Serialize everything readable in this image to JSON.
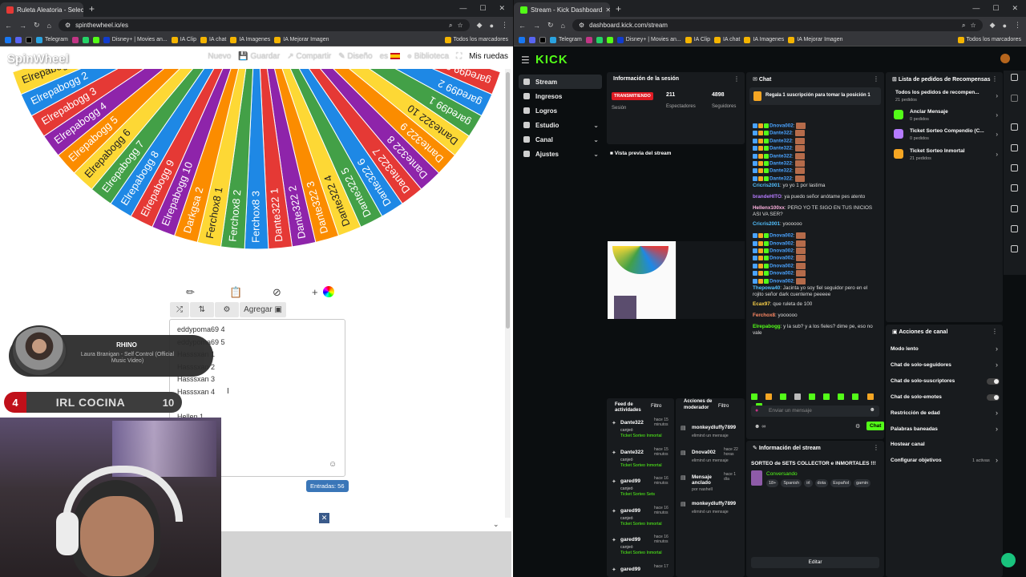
{
  "left_browser": {
    "tab_title": "Ruleta Aleatoria - Selector Pers...",
    "url": "spinthewheel.io/es",
    "bookmarks": [
      "Telegram",
      "Disney+ | Movies an...",
      "IA Clip",
      "IA chat",
      "IA Imagenes",
      "IA Mejorar Imagen"
    ],
    "bookmarks_end": "Todos los marcadores"
  },
  "spinwheel": {
    "logo": "SpinWheel",
    "menu": {
      "new": "Nuevo",
      "save": "Guardar",
      "share": "Compartir",
      "design": "Diseño",
      "lang": "es",
      "library": "Biblioteca",
      "my_wheels": "Mis ruedas"
    },
    "add_button": "Agregar",
    "wheel_segments": [
      {
        "label": "gared99 3",
        "color": "#e53935"
      },
      {
        "label": "gared99 2",
        "color": "#1e88e5"
      },
      {
        "label": "gared99 1",
        "color": "#43a047"
      },
      {
        "label": "Dante322 10",
        "color": "#fdd835"
      },
      {
        "label": "Dante322 9",
        "color": "#fb8c00"
      },
      {
        "label": "Dante322 8",
        "color": "#8e24aa"
      },
      {
        "label": "Dante322 7",
        "color": "#e53935"
      },
      {
        "label": "Dante322 6",
        "color": "#1e88e5"
      },
      {
        "label": "Dante322 5",
        "color": "#43a047"
      },
      {
        "label": "Dante322 4",
        "color": "#fdd835"
      },
      {
        "label": "Dante322 3",
        "color": "#fb8c00"
      },
      {
        "label": "Dante322 2",
        "color": "#8e24aa"
      },
      {
        "label": "Dante322 1",
        "color": "#e53935"
      },
      {
        "label": "Ferchox8 3",
        "color": "#1e88e5"
      },
      {
        "label": "Ferchox8 2",
        "color": "#43a047"
      },
      {
        "label": "Ferchox8 1",
        "color": "#fdd835"
      },
      {
        "label": "Darkgsa 2",
        "color": "#fb8c00"
      },
      {
        "label": "Elrepabogg 10",
        "color": "#8e24aa"
      },
      {
        "label": "Elrepabogg 9",
        "color": "#e53935"
      },
      {
        "label": "Elrepabogg 8",
        "color": "#1e88e5"
      },
      {
        "label": "Elrepabogg 7",
        "color": "#43a047"
      },
      {
        "label": "Elrepabogg 6",
        "color": "#fdd835"
      },
      {
        "label": "Elrepabogg 5",
        "color": "#fb8c00"
      },
      {
        "label": "Elrepabogg 4",
        "color": "#8e24aa"
      },
      {
        "label": "Elrepabogg 3",
        "color": "#e53935"
      },
      {
        "label": "Elrepabogg 2",
        "color": "#1e88e5"
      },
      {
        "label": "Elrepabogg 1",
        "color": "#fdd835"
      }
    ],
    "entries": [
      "eddypoma69 4",
      "eddypoma69 5",
      "Hasssxan 1",
      "Hasssxan 2",
      "Hasssxan 3",
      "Hasssxan 4",
      "",
      "Hellen 1"
    ],
    "entries_count": "Entradas: 56"
  },
  "overlay": {
    "music_artist": "RHINO",
    "music_song": "Laura Branigan - Self Control (Official Music Video)",
    "irl_left": "4",
    "irl_label": "IRL COCINA",
    "irl_right": "10"
  },
  "right_browser": {
    "tab_title": "Stream - Kick Dashboard",
    "url": "dashboard.kick.com/stream",
    "bookmarks": [
      "Telegram",
      "Disney+ | Movies an...",
      "IA Clip",
      "IA chat",
      "IA Imagenes",
      "IA Mejorar Imagen"
    ],
    "bookmarks_end": "Todos los marcadores"
  },
  "kick": {
    "logo": "KICK",
    "nav": [
      {
        "label": "Stream",
        "active": true,
        "chevron": false
      },
      {
        "label": "Ingresos",
        "active": false,
        "chevron": false
      },
      {
        "label": "Logros",
        "active": false,
        "chevron": false
      },
      {
        "label": "Estudio",
        "active": false,
        "chevron": true
      },
      {
        "label": "Canal",
        "active": false,
        "chevron": true
      },
      {
        "label": "Ajustes",
        "active": false,
        "chevron": true
      }
    ],
    "session": {
      "title": "Información de la sesión",
      "live_badge": "TRANSMITIENDO",
      "session_label": "Sesión",
      "viewers": "211",
      "viewers_label": "Espectadores",
      "followers": "4898",
      "followers_label": "Seguidores"
    },
    "preview_title": "Vista previa del stream",
    "activity": {
      "title": "Feed de actividades",
      "filter": "Filtro",
      "items": [
        {
          "user": "Dante322",
          "time": "hace 15 minutos",
          "action": "canjeó",
          "reward": "Ticket Sorteo Inmortal"
        },
        {
          "user": "Dante322",
          "time": "hace 15 minutos",
          "action": "canjeó",
          "reward": "Ticket Sorteo Inmortal"
        },
        {
          "user": "gared99",
          "time": "hace 16 minutos",
          "action": "canjeó",
          "reward": "Ticket Sorteo Sets"
        },
        {
          "user": "gared99",
          "time": "hace 16 minutos",
          "action": "canjeó",
          "reward": "Ticket Sorteo Inmortal"
        },
        {
          "user": "gared99",
          "time": "hace 16 minutos",
          "action": "canjeó",
          "reward": "Ticket Sorteo Inmortal"
        },
        {
          "user": "gared99",
          "time": "hace 17",
          "action": "",
          "reward": ""
        }
      ]
    },
    "mod": {
      "title": "Acciones de moderador",
      "filter": "Filtro",
      "items": [
        {
          "user": "monkeydluffy7899",
          "time": "",
          "action": "eliminó un mensaje"
        },
        {
          "user": "Dnova002",
          "time": "hace 22 horas",
          "action": "eliminó un mensaje"
        },
        {
          "user": "Mensaje anclado",
          "time": "hace 1 día",
          "action": "por nashell"
        },
        {
          "user": "monkeydluffy7899",
          "time": "",
          "action": "eliminó un mensaje"
        }
      ]
    },
    "chat": {
      "title": "Chat",
      "pinned": "Regala 1 suscripción para tomar la posición 1",
      "lines": [
        {
          "user": "Dnova002",
          "color": "#4aa3ff",
          "text": ""
        },
        {
          "user": "Dante322",
          "color": "#4aa3ff",
          "text": ""
        },
        {
          "user": "Dante322",
          "color": "#4aa3ff",
          "text": ""
        },
        {
          "user": "Dante322",
          "color": "#4aa3ff",
          "text": ""
        },
        {
          "user": "Dante322",
          "color": "#4aa3ff",
          "text": ""
        },
        {
          "user": "Dante322",
          "color": "#4aa3ff",
          "text": ""
        },
        {
          "user": "Dante322",
          "color": "#4aa3ff",
          "text": ""
        },
        {
          "user": "Dante322",
          "color": "#4aa3ff",
          "text": ""
        },
        {
          "user": "Cricris2001",
          "color": "#53c0ff",
          "text": "yo yo 1 por lastima"
        },
        {
          "user": "brandeHITO",
          "color": "#b57bff",
          "text": "ya puedo señor anótame pes atento"
        },
        {
          "user": "Hellenx100xx",
          "color": "#ffb2e0",
          "text": "PERO YO TE SIGO EN TUS INICIOS ASI VA SER?"
        },
        {
          "user": "Cricris2001",
          "color": "#53c0ff",
          "text": "yoooooo"
        },
        {
          "user": "Dnova002",
          "color": "#4aa3ff",
          "text": ""
        },
        {
          "user": "Dnova002",
          "color": "#4aa3ff",
          "text": ""
        },
        {
          "user": "Dnova002",
          "color": "#4aa3ff",
          "text": ""
        },
        {
          "user": "Dnova002",
          "color": "#4aa3ff",
          "text": ""
        },
        {
          "user": "Dnova002",
          "color": "#4aa3ff",
          "text": ""
        },
        {
          "user": "Dnova002",
          "color": "#4aa3ff",
          "text": ""
        },
        {
          "user": "Dnova002",
          "color": "#4aa3ff",
          "text": ""
        },
        {
          "user": "Thepowa40",
          "color": "#53c0ff",
          "text": "Jacinta yo soy fiel seguidor pero en el rojito señor dark cuenteme peeeee"
        },
        {
          "user": "Ecax97",
          "color": "#ffd54a",
          "text": "que ruleta de 100"
        },
        {
          "user": "Ferchox8",
          "color": "#ff8a65",
          "text": "yoooooo"
        },
        {
          "user": "Elrepabogg",
          "color": "#53fc18",
          "text": "y la sub? y a los fieles? dime pe, eso no vale"
        }
      ],
      "input_placeholder": "Enviar un mensaje",
      "send": "Chat"
    },
    "stream_info": {
      "title": "Información del stream",
      "stream_title": "SORTEO de SETS COLLECTOR e INMORTALES !!!",
      "category": "Conversando",
      "tags": [
        "18+",
        "Spanish",
        "irl",
        "dota",
        "Español",
        "gamin"
      ],
      "edit": "Editar"
    },
    "rewards": {
      "title": "Lista de pedidos de Recompensas",
      "items": [
        {
          "name": "Todos los pedidos de recompen...",
          "sub": "21 pedidos"
        },
        {
          "name": "Anclar Mensaje",
          "sub": "0 pedidos"
        },
        {
          "name": "Ticket Sorteo Compendio (C...",
          "sub": "0 pedidos"
        },
        {
          "name": "Ticket Sorteo Inmortal",
          "sub": "21 pedidos"
        }
      ]
    },
    "channel_actions": {
      "title": "Acciones de canal",
      "items": [
        {
          "label": "Modo lento",
          "ctrl": "chevron",
          "extra": ""
        },
        {
          "label": "Chat de solo-seguidores",
          "ctrl": "chevron",
          "extra": ""
        },
        {
          "label": "Chat de solo-suscriptores",
          "ctrl": "toggle",
          "extra": ""
        },
        {
          "label": "Chat de solo-emotes",
          "ctrl": "toggle",
          "extra": ""
        },
        {
          "label": "Restricción de edad",
          "ctrl": "chevron",
          "extra": ""
        },
        {
          "label": "Palabras baneadas",
          "ctrl": "chevron",
          "extra": ""
        },
        {
          "label": "Hostear canal",
          "ctrl": "none",
          "extra": ""
        },
        {
          "label": "Configurar objetivos",
          "ctrl": "chevron",
          "extra": "1 activas"
        }
      ]
    }
  }
}
